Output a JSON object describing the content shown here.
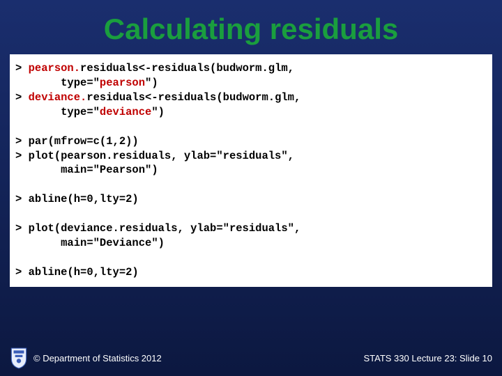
{
  "title": "Calculating residuals",
  "code": {
    "l1a": "> ",
    "l1b": "pearson.",
    "l1c": "residuals<-residuals(budworm.glm,",
    "l2a": "       type=\"",
    "l2b": "pearson",
    "l2c": "\")",
    "l3a": "> ",
    "l3b": "deviance.",
    "l3c": "residuals<-residuals(budworm.glm,",
    "l4a": "       type=\"",
    "l4b": "deviance",
    "l4c": "\")",
    "blank1": " ",
    "l5": "> par(mfrow=c(1,2))",
    "l6": "> plot(pearson.residuals, ylab=\"residuals\",",
    "l7": "       main=\"Pearson\")",
    "blank2": " ",
    "l8": "> abline(h=0,lty=2)",
    "blank3": " ",
    "l9": "> plot(deviance.residuals, ylab=\"residuals\",",
    "l10": "       main=\"Deviance\")",
    "blank4": " ",
    "l11": "> abline(h=0,lty=2)"
  },
  "footer": {
    "copyright": "© Department of Statistics 2012",
    "slideinfo": "STATS 330 Lecture 23: Slide 10"
  }
}
